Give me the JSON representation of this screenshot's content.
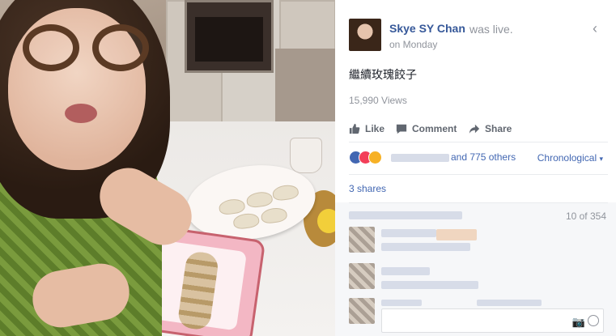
{
  "post": {
    "author": "Skye SY Chan",
    "status": "was live.",
    "time": "on Monday",
    "caption": "繼續玫瑰餃子",
    "views": "15,990 Views"
  },
  "actions": {
    "like": "Like",
    "comment": "Comment",
    "share": "Share"
  },
  "reactions": {
    "others_text": "and 775 others",
    "sort_label": "Chronological",
    "sort_caret": "▾"
  },
  "shares": {
    "label": "3 shares"
  },
  "comments": {
    "count_text": "10 of 354"
  },
  "icons": {
    "back": "chevron-left-icon",
    "like": "thumbs-up-icon",
    "comment": "speech-bubble-icon",
    "share": "share-arrow-icon",
    "camera": "camera-icon",
    "emoji": "smiley-icon"
  },
  "colors": {
    "link": "#365899",
    "accent": "#4267b2",
    "muted": "#90949c",
    "love": "#f33e58",
    "haha": "#f7b125"
  }
}
